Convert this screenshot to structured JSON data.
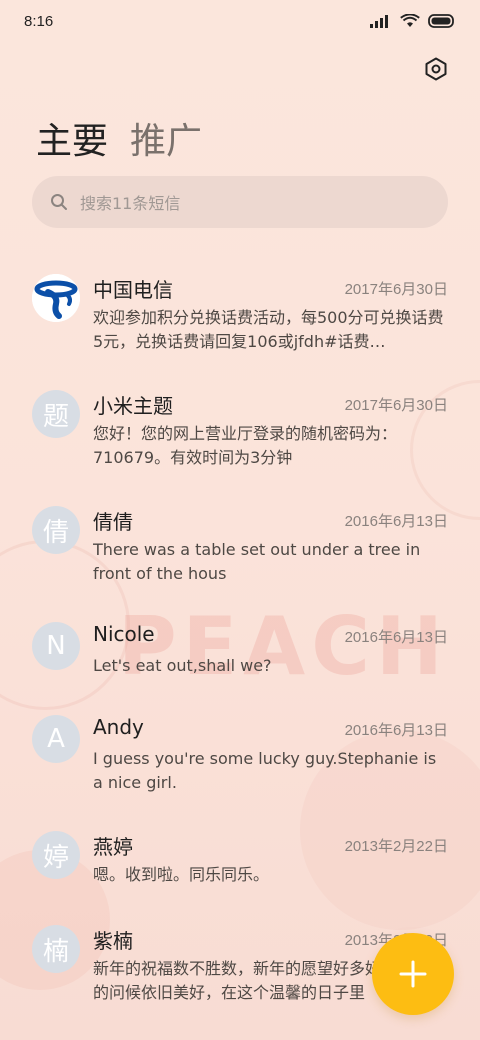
{
  "status_bar": {
    "time": "8:16"
  },
  "tabs": [
    {
      "label": "主要",
      "active": true
    },
    {
      "label": "推广",
      "active": false
    }
  ],
  "search": {
    "placeholder": "搜索11条短信"
  },
  "conversations": [
    {
      "name": "中国电信",
      "date": "2017年6月30日",
      "preview": "欢迎参加积分兑换话费活动，每500分可兑换话费5元，兑换话费请回复106或jfdh#话费…",
      "avatar": "china-telecom-logo"
    },
    {
      "name": "小米主题",
      "date": "2017年6月30日",
      "preview": "您好！您的网上营业厅登录的随机密码为：710679。有效时间为3分钟",
      "avatar": "题"
    },
    {
      "name": "倩倩",
      "date": "2016年6月13日",
      "preview": "There was a table set out under a tree in front of the hous",
      "avatar": "倩"
    },
    {
      "name": "Nicole",
      "date": "2016年6月13日",
      "preview": "Let's eat out,shall we?",
      "avatar": "N"
    },
    {
      "name": "Andy",
      "date": "2016年6月13日",
      "preview": "I guess you're some lucky guy.Stephanie is a nice girl.",
      "avatar": "A"
    },
    {
      "name": "燕婷",
      "date": "2013年2月22日",
      "preview": "嗯。收到啦。同乐同乐。",
      "avatar": "婷"
    },
    {
      "name": "紫楠",
      "date": "2013年2月22日",
      "preview": "新年的祝福数不胜数，新年的愿望好多好多，新年的问候依旧美好，在这个温馨的日子里",
      "avatar": "楠"
    }
  ],
  "background_text": "PEACH",
  "colors": {
    "fab": "#fdbd12",
    "avatar_bg": "#d8dde4",
    "telecom_blue": "#0b4fa8"
  }
}
